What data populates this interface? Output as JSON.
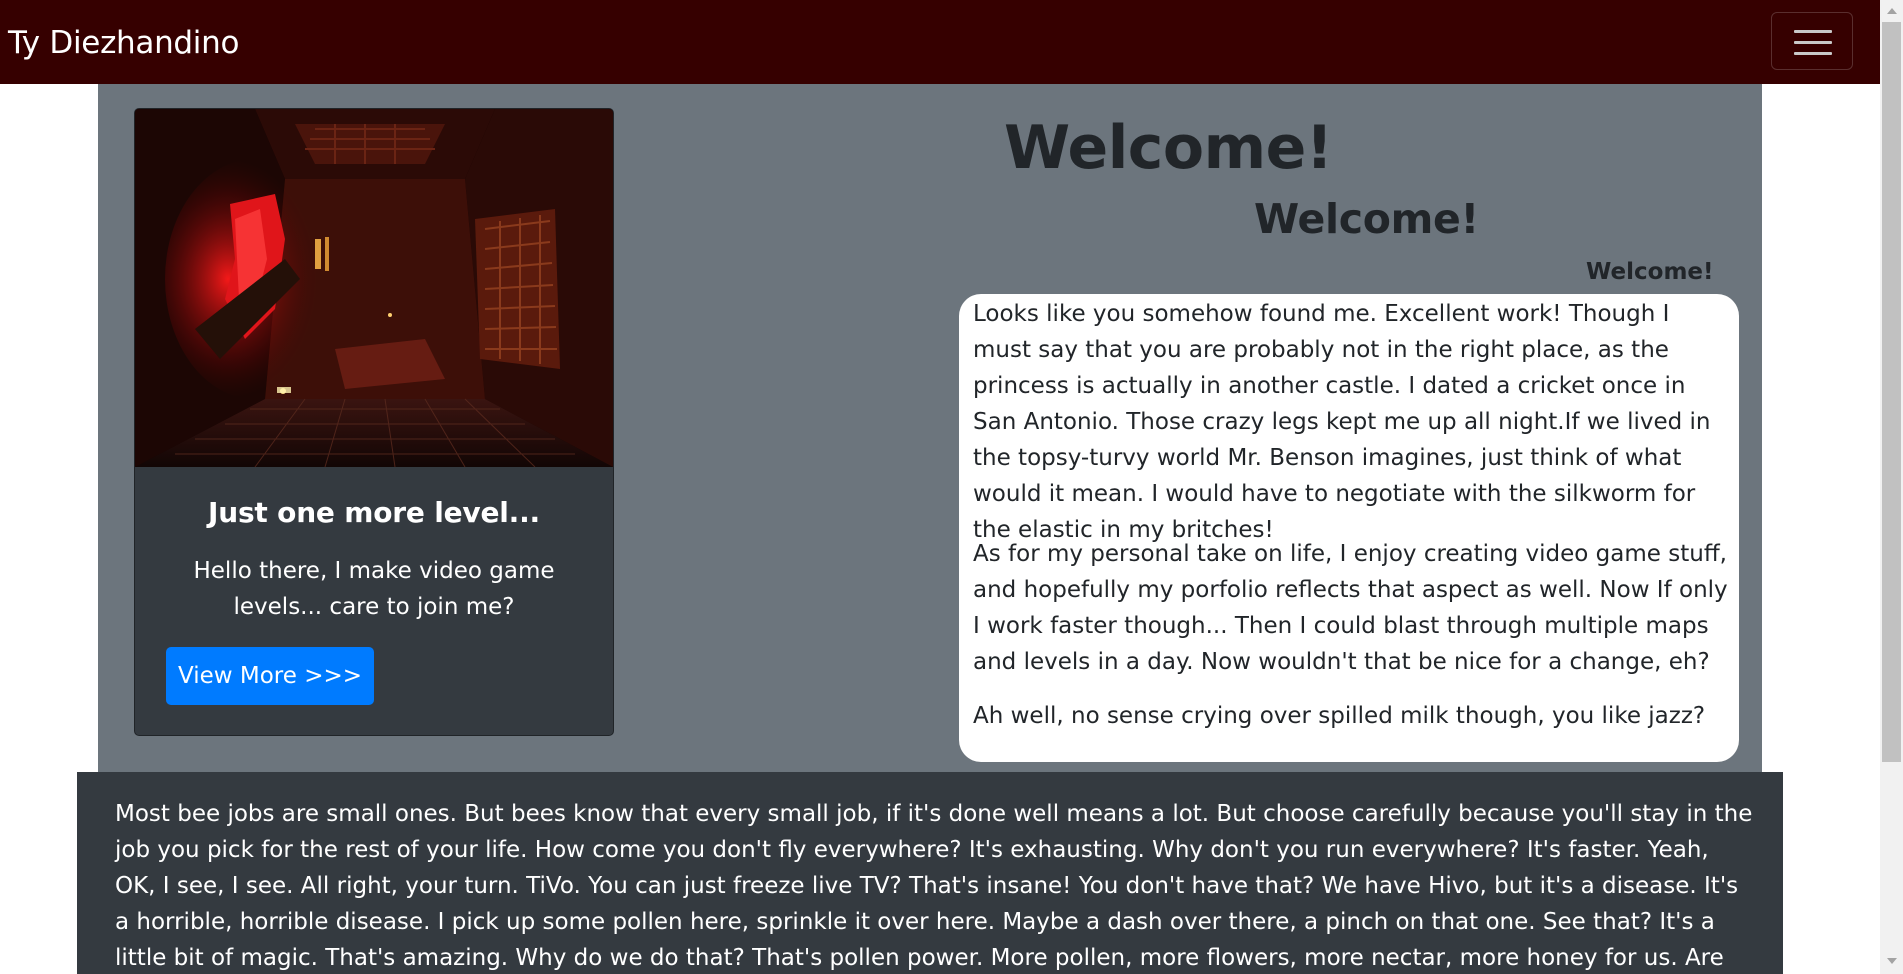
{
  "navbar": {
    "brand": "Ty Diezhandino",
    "toggler_icon": "hamburger-menu-icon"
  },
  "card": {
    "image_alt": "Dark red-lit game level corridor with ornate metal wall panels",
    "title": "Just one more level...",
    "text": "Hello there, I make video game levels... care to join me?",
    "button_label": "View More >>>"
  },
  "headings": {
    "h1": "Welcome!",
    "h2": "Welcome!",
    "h3": "Welcome!"
  },
  "intro": {
    "paragraph1": "Looks like you somehow found me. Excellent work! Though I must say that you are probably not in the right place, as the princess is actually in another castle. I dated a cricket once in San Antonio. Those crazy legs kept me up all night.If we lived in the topsy-turvy world Mr. Benson imagines, just think of what would it mean. I would have to negotiate with the silkworm for the elastic in my britches!",
    "paragraph2": "As for my personal take on life, I enjoy creating video game stuff, and hopefully my porfolio reflects that aspect as well. Now If only I work faster though... Then I could blast through multiple maps and levels in a day. Now wouldn't that be nice for a change, eh?",
    "paragraph3": "Ah well, no sense crying over spilled milk though, you like jazz?"
  },
  "lower_section": {
    "text": "Most bee jobs are small ones. But bees know that every small job, if it's done well means a lot. But choose carefully because you'll stay in the job you pick for the rest of your life. How come you don't fly everywhere? It's exhausting. Why don't you run everywhere? It's faster. Yeah, OK, I see, I see. All right, your turn. TiVo. You can just freeze live TV? That's insane! You don't have that? We have Hivo, but it's a disease. It's a horrible, horrible disease. I pick up some pollen here, sprinkle it over here. Maybe a dash over there, a pinch on that one. See that? It's a little bit of magic. That's amazing. Why do we do that? That's pollen power. More pollen, more flowers, more nectar, more honey for us. Are you all right? No. He's making the tie in the cab as they're"
  },
  "colors": {
    "navbar_bg": "#360000",
    "hero_bg": "#6c757d",
    "card_bg": "#343a40",
    "button_bg": "#007bff",
    "bubble_bg": "#ffffff",
    "lower_bg": "#343a40"
  }
}
